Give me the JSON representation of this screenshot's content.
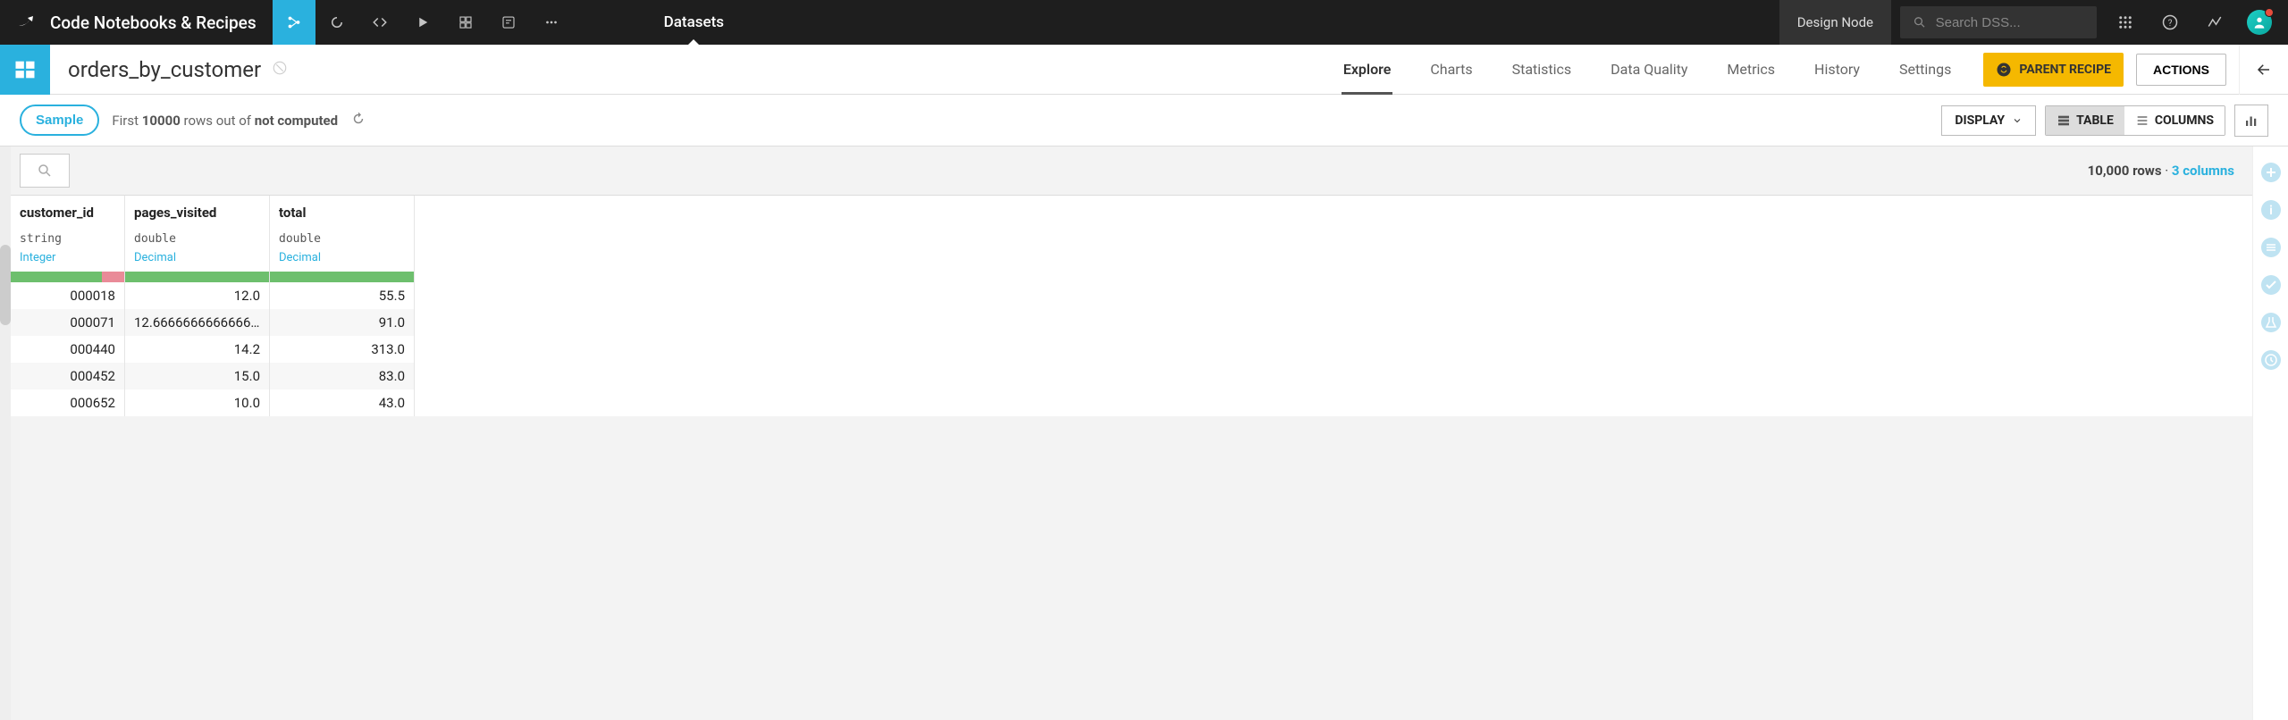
{
  "topbar": {
    "brand": "Code Notebooks & Recipes",
    "active_tab": "Datasets",
    "design_node": "Design Node",
    "search_placeholder": "Search DSS..."
  },
  "secondbar": {
    "title": "orders_by_customer",
    "tabs": [
      "Explore",
      "Charts",
      "Statistics",
      "Data Quality",
      "Metrics",
      "History",
      "Settings"
    ],
    "active_tab": "Explore",
    "parent_recipe": "PARENT RECIPE",
    "actions": "ACTIONS"
  },
  "thirdbar": {
    "sample": "Sample",
    "sample_prefix": "First ",
    "sample_rows": "10000",
    "sample_mid": " rows out of ",
    "sample_status": "not computed",
    "display": "DISPLAY",
    "table": "TABLE",
    "columns": "COLUMNS"
  },
  "filter": {
    "rows": "10,000 rows",
    "sep": " · ",
    "cols": "3 columns"
  },
  "table": {
    "columns": [
      {
        "name": "customer_id",
        "storage": "string",
        "semantic": "Integer",
        "bad_pct": 20
      },
      {
        "name": "pages_visited",
        "storage": "double",
        "semantic": "Decimal",
        "bad_pct": 0
      },
      {
        "name": "total",
        "storage": "double",
        "semantic": "Decimal",
        "bad_pct": 0
      }
    ],
    "rows": [
      [
        "000018",
        "12.0",
        "55.5"
      ],
      [
        "000071",
        "12.666666666666666",
        "91.0"
      ],
      [
        "000440",
        "14.2",
        "313.0"
      ],
      [
        "000452",
        "15.0",
        "83.0"
      ],
      [
        "000652",
        "10.0",
        "43.0"
      ]
    ]
  }
}
